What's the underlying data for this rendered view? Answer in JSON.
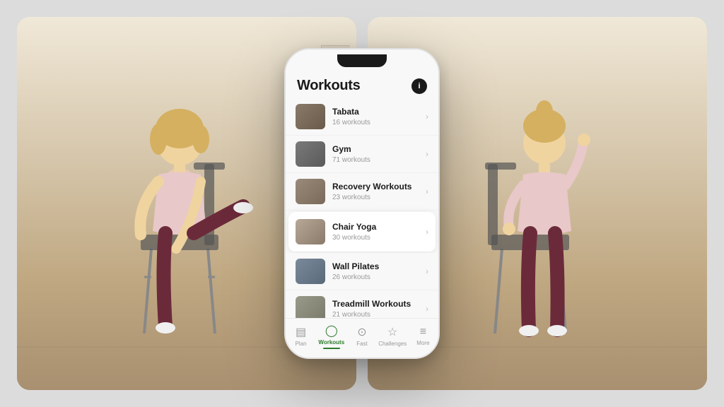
{
  "scene": {
    "background_color": "#dcdcdc"
  },
  "phone": {
    "header": {
      "title": "Workouts",
      "icon_label": "i"
    },
    "workouts": [
      {
        "id": "tabata",
        "name": "Tabata",
        "count": "16 workouts",
        "active": false,
        "thumb_class": "thumb-tabata"
      },
      {
        "id": "gym",
        "name": "Gym",
        "count": "71 workouts",
        "active": false,
        "thumb_class": "thumb-gym"
      },
      {
        "id": "recovery",
        "name": "Recovery Workouts",
        "count": "23 workouts",
        "active": false,
        "thumb_class": "thumb-recovery"
      },
      {
        "id": "chairyoga",
        "name": "Chair Yoga",
        "count": "30 workouts",
        "active": true,
        "thumb_class": "thumb-chairyoga"
      },
      {
        "id": "wallpilates",
        "name": "Wall Pilates",
        "count": "26 workouts",
        "active": false,
        "thumb_class": "thumb-wallpilates"
      },
      {
        "id": "treadmill",
        "name": "Treadmill Workouts",
        "count": "21 workouts",
        "active": false,
        "thumb_class": "thumb-treadmill"
      }
    ],
    "bottom_nav": [
      {
        "id": "plan",
        "label": "Plan",
        "icon": "📋",
        "active": false
      },
      {
        "id": "workouts",
        "label": "Workouts",
        "icon": "🏃",
        "active": true
      },
      {
        "id": "fast",
        "label": "Fast",
        "icon": "⏱",
        "active": false
      },
      {
        "id": "challenges",
        "label": "Challenges",
        "icon": "🏆",
        "active": false
      },
      {
        "id": "more",
        "label": "More",
        "icon": "☰",
        "active": false
      }
    ]
  }
}
